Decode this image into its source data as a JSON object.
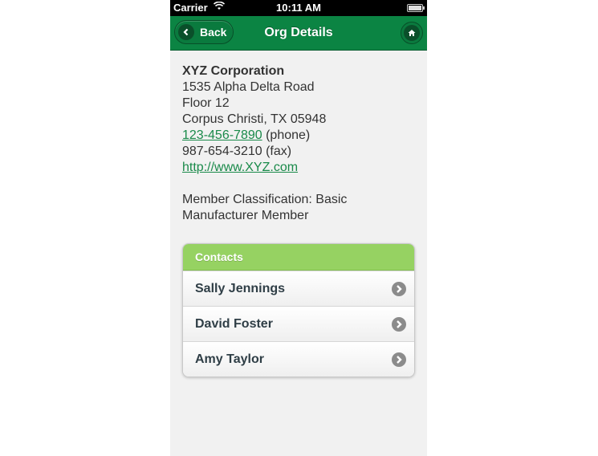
{
  "status_bar": {
    "carrier": "Carrier",
    "time": "10:11 AM",
    "wifi_icon": "wifi-icon",
    "battery_icon": "battery-icon"
  },
  "navbar": {
    "title": "Org Details",
    "back_label": "Back",
    "back_icon": "chevron-left-icon",
    "home_icon": "home-icon"
  },
  "org": {
    "name": "XYZ Corporation",
    "address_line1": "1535 Alpha Delta Road",
    "address_line2": "Floor 12",
    "city_state_zip": "Corpus Christi, TX 05948",
    "phone": "123-456-7890",
    "phone_suffix": " (phone)",
    "fax": "987-654-3210 (fax)",
    "website": "http://www.XYZ.com",
    "classification": "Member Classification: Basic Manufacturer Member"
  },
  "contacts": {
    "header": "Contacts",
    "items": [
      {
        "name": "Sally Jennings"
      },
      {
        "name": "David Foster"
      },
      {
        "name": "Amy Taylor"
      }
    ]
  },
  "colors": {
    "navbar": "#0b8443",
    "contacts_header": "#96d262",
    "link": "#1a8a4a"
  }
}
